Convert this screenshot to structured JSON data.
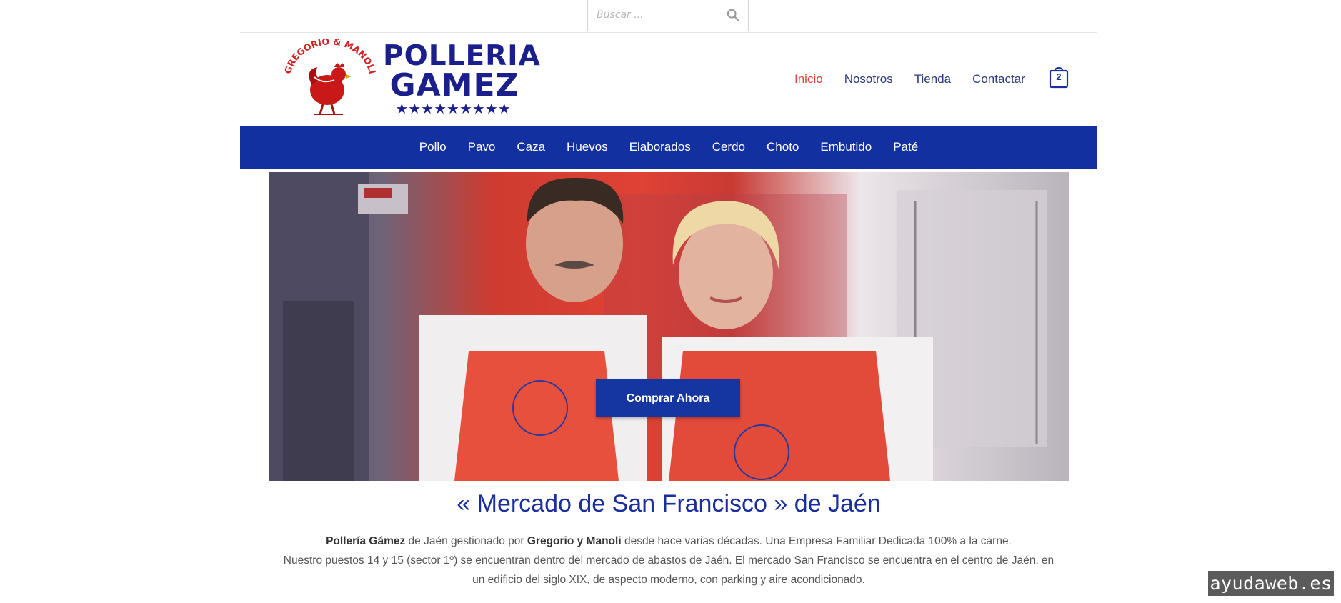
{
  "search": {
    "placeholder": "Buscar ..."
  },
  "logo": {
    "wordmark_line1": "POLLERIA",
    "wordmark_line2": "GAMEZ",
    "emblem_text": "GREGORIO & MANOLI",
    "stars": "★★★★★★★★★",
    "colors": {
      "primary": "#1b1f8c",
      "emblem": "#d32020"
    }
  },
  "nav": {
    "items": [
      {
        "label": "Inicio",
        "active": true
      },
      {
        "label": "Nosotros",
        "active": false
      },
      {
        "label": "Tienda",
        "active": false
      },
      {
        "label": "Contactar",
        "active": false
      }
    ],
    "cart_count": "2",
    "cart_icon": "shopping-bag-icon"
  },
  "categories": [
    "Pollo",
    "Pavo",
    "Caza",
    "Huevos",
    "Elaborados",
    "Cerdo",
    "Choto",
    "Embutido",
    "Paté"
  ],
  "hero": {
    "button_label": "Comprar Ahora"
  },
  "content": {
    "title": "« Mercado de San Francisco » de Jaén",
    "intro_p1_bold": "Pollería Gámez",
    "intro_p1_a": " de Jaén gestionado por ",
    "intro_p1_bold2": "Gregorio y Manoli",
    "intro_p1_b": " desde hace varias décadas. Una Empresa Familiar Dedicada 100% a la carne.",
    "intro_p2": "Nuestro puestos 14 y 15 (sector 1º) se encuentran dentro del mercado de abastos de Jaén. El mercado San Francisco se encuentra en el centro de Jaén, en un edificio del siglo XIX, de aspecto moderno, con parking y aire acondicionado."
  },
  "watermark": "ayudaweb.es",
  "colors": {
    "brand_blue": "#1230a0",
    "active_nav": "#e2403a",
    "nav_text": "#2a3a7a"
  }
}
